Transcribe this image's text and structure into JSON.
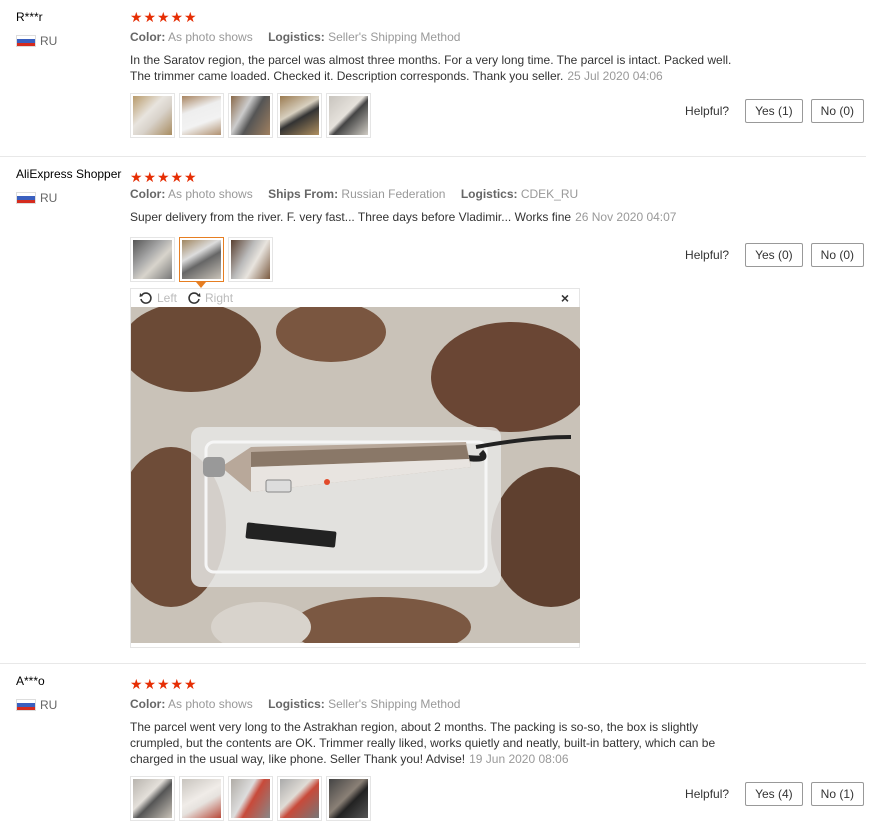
{
  "labels": {
    "color": "Color:",
    "logistics": "Logistics:",
    "ships_from": "Ships From:",
    "helpful": "Helpful?"
  },
  "reviews": [
    {
      "user": "R***r",
      "country": "RU",
      "rating": 5,
      "color_value": "As photo shows",
      "logistics_value": "Seller's Shipping Method",
      "text_lines": [
        "In the Saratov region, the parcel was almost three months. For a very long time. The parcel is intact. Packed well.",
        "The trimmer came loaded. Checked it. Description corresponds. Thank you seller."
      ],
      "date": "25 Jul 2020 04:06",
      "yes": "Yes (1)",
      "no": "No (0)"
    },
    {
      "user": "AliExpress Shopper",
      "country": "RU",
      "rating": 5,
      "color_value": "As photo shows",
      "ships_from_value": "Russian Federation",
      "logistics_value": "CDEK_RU",
      "text": "Super delivery from the river. F. very fast... Three days before Vladimir... Works fine",
      "date": "26 Nov 2020 04:07",
      "yes": "Yes (0)",
      "no": "No (0)",
      "viewer": {
        "left": "Left",
        "right": "Right",
        "close": "×"
      }
    },
    {
      "user": "A***o",
      "country": "RU",
      "rating": 5,
      "color_value": "As photo shows",
      "logistics_value": "Seller's Shipping Method",
      "text_lines": [
        "The parcel went very long to the Astrakhan region, about 2 months. The packing is so-so, the box is slightly",
        "crumpled, but the contents are OK. Trimmer really liked, works quietly and neatly, built-in battery, which can be",
        "charged in the usual way, like phone. Seller Thank you! Advise!"
      ],
      "date": "19 Jun 2020 08:06",
      "yes": "Yes (4)",
      "no": "No (1)"
    }
  ],
  "colors": {
    "star": "#e62e04",
    "active_thumb": "#e67e22"
  },
  "icons": {
    "star": "star-icon",
    "flag": "russia-flag-icon",
    "rotate_left": "rotate-left-icon",
    "rotate_right": "rotate-right-icon",
    "close": "close-icon"
  }
}
